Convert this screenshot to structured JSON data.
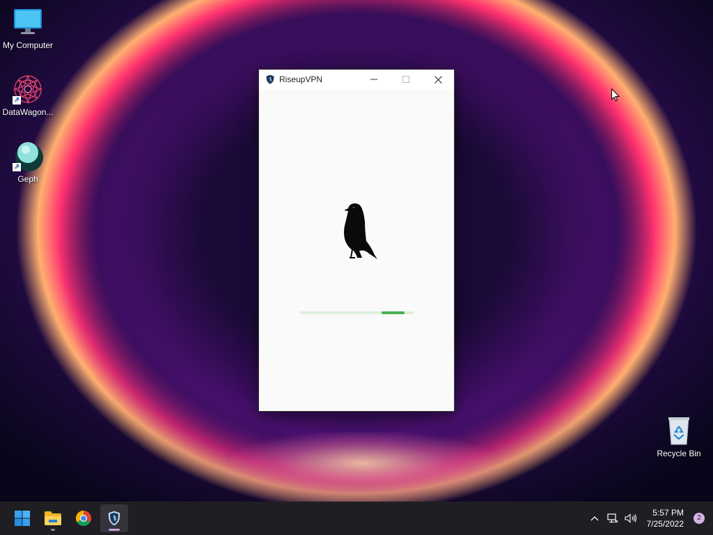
{
  "desktop": {
    "icons": [
      {
        "label": "My Computer",
        "icon": "monitor-icon"
      },
      {
        "label": "DataWagon...",
        "icon": "datawagon-icon"
      },
      {
        "label": "Geph",
        "icon": "geph-icon"
      },
      {
        "label": "Recycle Bin",
        "icon": "recycle-bin-icon"
      }
    ]
  },
  "window": {
    "title": "RiseupVPN",
    "icon": "riseup-shield-icon",
    "controls": {
      "minimize": "minimize-icon",
      "maximize": "maximize-icon",
      "close": "close-icon"
    },
    "logo": "crow-icon",
    "progress": {
      "start": 0.72,
      "end": 0.92,
      "color": "#4caf50",
      "track_color": "#dcefdc"
    }
  },
  "taskbar": {
    "apps": [
      {
        "name": "start",
        "icon": "windows-start-icon"
      },
      {
        "name": "file-explorer",
        "icon": "folder-icon"
      },
      {
        "name": "chrome",
        "icon": "chrome-icon"
      },
      {
        "name": "riseupvpn",
        "icon": "riseup-shield-icon",
        "active": true
      }
    ],
    "tray": {
      "icons": [
        "chevron-up-icon",
        "network-icon",
        "volume-icon"
      ],
      "time": "5:57 PM",
      "date": "7/25/2022",
      "notifications": "2"
    }
  },
  "colors": {
    "accent": "#4caf50",
    "taskbar": "#1f1f23"
  }
}
